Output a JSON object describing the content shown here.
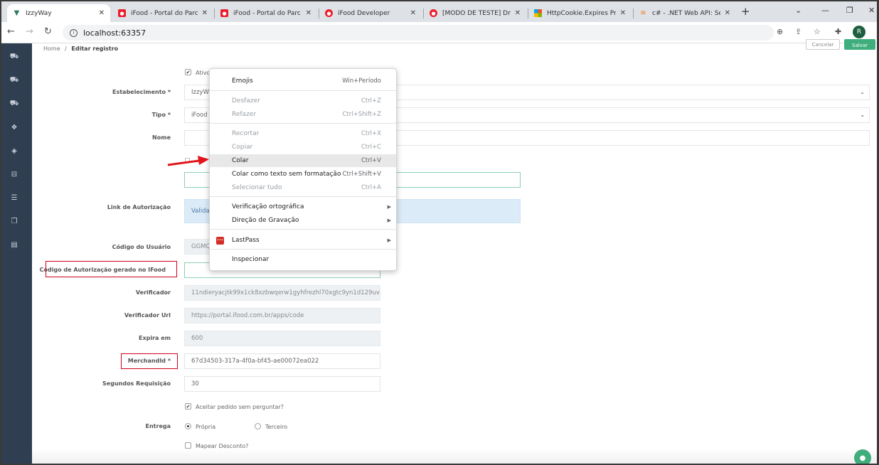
{
  "browser": {
    "tabs": [
      {
        "label": "IzzyWay",
        "favicon": "izzyway-icon",
        "color": "#2e7d5b"
      },
      {
        "label": "iFood - Portal do Parc",
        "favicon": "ifood-icon",
        "color": "#ea1d2c"
      },
      {
        "label": "iFood - Portal do Parc",
        "favicon": "ifood-icon",
        "color": "#ea1d2c"
      },
      {
        "label": "iFood Developer",
        "favicon": "ifood-icon",
        "color": "#ea1d2c"
      },
      {
        "label": "[MODO DE TESTE] Dr",
        "favicon": "ifood-icon",
        "color": "#ea1d2c"
      },
      {
        "label": "HttpCookie.Expires Pr",
        "favicon": "microsoft-icon",
        "color": "#f25022"
      },
      {
        "label": "c# - .NET Web API: Se",
        "favicon": "stackoverflow-icon",
        "color": "#f48024"
      }
    ],
    "address": "localhost:63357",
    "profile_initial": "R"
  },
  "breadcrumb": {
    "home": "Home",
    "separator": "/",
    "current": "Editar registro"
  },
  "actions": {
    "cancel": "Cancelar",
    "save": "Salvar"
  },
  "form": {
    "ativo_label": "Ativo",
    "estabelecimento": {
      "label": "Estabelecimento *",
      "value": "IzzyW"
    },
    "tipo": {
      "label": "Tipo *",
      "value": "iFood"
    },
    "nome": {
      "label": "Nome",
      "value": ""
    },
    "link": {
      "label": "Link de Autorização",
      "value": "Valida"
    },
    "codigo_usuario": {
      "label": "Código do Usuário",
      "value": "GGMQ"
    },
    "codigo_autorizacao": {
      "label": "Código de Autorização gerado no IFood",
      "value": ""
    },
    "verificador": {
      "label": "Verificador",
      "value": "11ndieryacjtk99x1ck8xzbwqerw1gyhfrezhl70xgtc9yn1d129uv"
    },
    "verificador_url": {
      "label": "Verificador Url",
      "value": "https://portal.ifood.com.br/apps/code"
    },
    "expira_em": {
      "label": "Expira em",
      "value": "600"
    },
    "merchant_id": {
      "label": "MerchandId *",
      "value": "67d34503-317a-4f0a-bf45-ae00072ea022"
    },
    "segundos_requisicao": {
      "label": "Segundos Requisição",
      "value": "30"
    },
    "aceitar_label": "Aceitar pedido sem perguntar?",
    "entrega": {
      "label": "Entrega",
      "option1": "Própria",
      "option2": "Terceiro"
    },
    "mapear_label": "Mapear Desconto?"
  },
  "context_menu": {
    "items": [
      {
        "label": "Emojis",
        "shortcut": "Win+Período"
      },
      {
        "label": "Desfazer",
        "shortcut": "Ctrl+Z"
      },
      {
        "label": "Refazer",
        "shortcut": "Ctrl+Shift+Z"
      },
      {
        "label": "Recortar",
        "shortcut": "Ctrl+X"
      },
      {
        "label": "Copiar",
        "shortcut": "Ctrl+C"
      },
      {
        "label": "Colar",
        "shortcut": "Ctrl+V"
      },
      {
        "label": "Colar como texto sem formatação",
        "shortcut": "Ctrl+Shift+V"
      },
      {
        "label": "Selecionar tudo",
        "shortcut": "Ctrl+A"
      },
      {
        "label": "Verificação ortográfica"
      },
      {
        "label": "Direção de Gravação"
      },
      {
        "label": "LastPass"
      },
      {
        "label": "Inspecionar"
      }
    ],
    "lastpass_icon_text": "•••"
  },
  "colors": {
    "sidebar": "#2f3f51",
    "accent": "#3fae7c",
    "highlight": "#d0021b"
  }
}
